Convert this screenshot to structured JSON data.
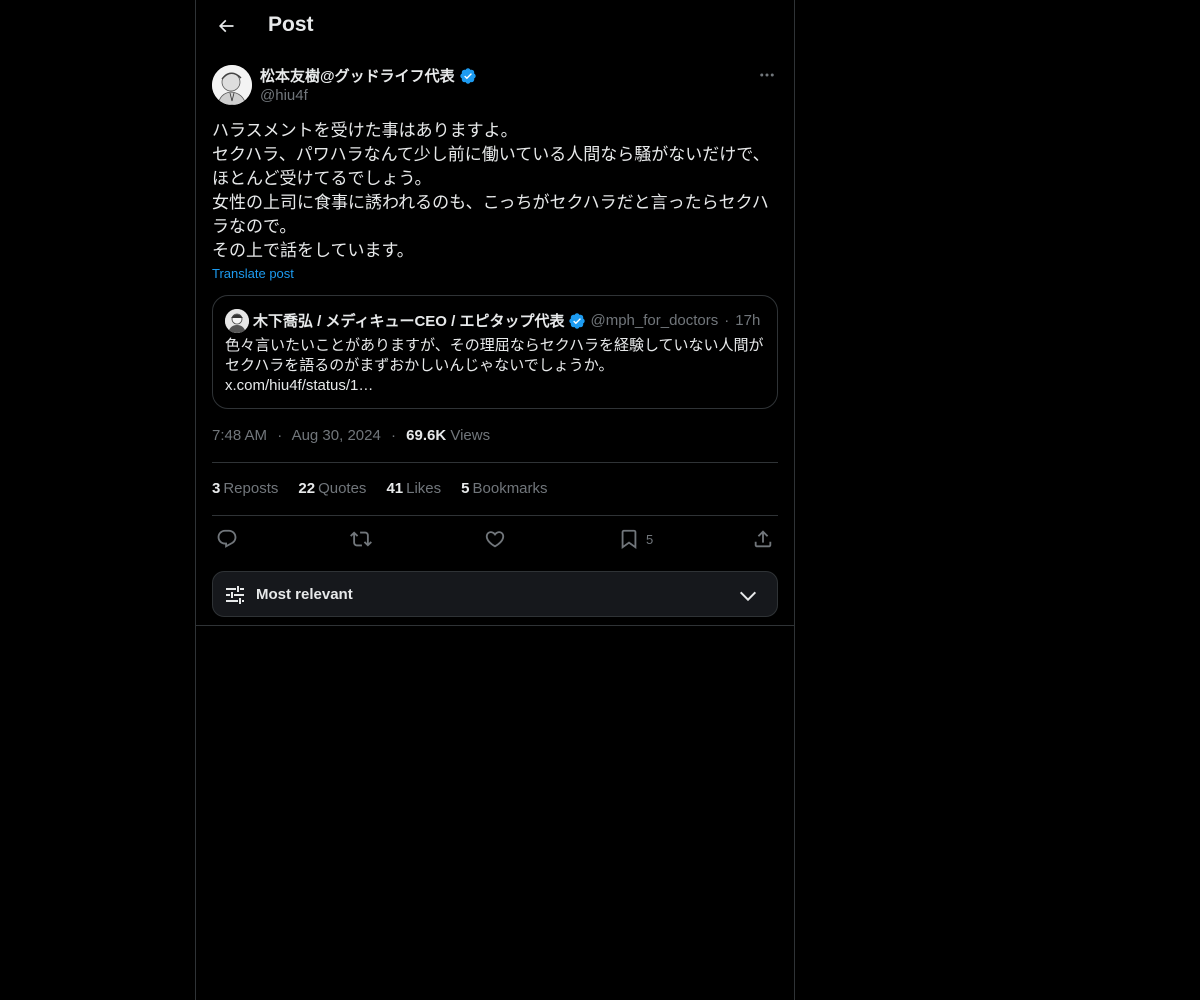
{
  "header": {
    "title": "Post"
  },
  "post": {
    "author_name": "松本友樹@グッドライフ代表",
    "author_handle": "@hiu4f",
    "body_lines": [
      "ハラスメントを受けた事はありますよ。",
      "セクハラ、パワハラなんて少し前に働いている人間なら騒がないだけで、",
      "ほとんど受けてるでしょう。",
      "女性の上司に食事に誘われるのも、こっちがセクハラだと言ったらセクハ",
      "ラなので。",
      "その上で話をしています。"
    ],
    "translate_label": "Translate post",
    "time": "7:48 AM",
    "date": "Aug 30, 2024",
    "views_count": "69.6K",
    "views_label": "Views"
  },
  "quote": {
    "author_name": "木下喬弘 / メディキューCEO / エピタップ代表",
    "author_handle": "@mph_for_doctors",
    "separator": "·",
    "time": "17h",
    "text_lines": [
      "色々言いたいことがありますが、その理屈ならセクハラを経験していない人間が",
      "セクハラを語るのがまずおかしいんじゃないでしょうか。",
      "x.com/hiu4f/status/1…"
    ]
  },
  "stats": [
    {
      "count": "3",
      "label": "Reposts"
    },
    {
      "count": "22",
      "label": "Quotes"
    },
    {
      "count": "41",
      "label": "Likes"
    },
    {
      "count": "5",
      "label": "Bookmarks"
    }
  ],
  "actions": {
    "reply_icon": "reply-icon",
    "repost_icon": "repost-icon",
    "like_icon": "heart-icon",
    "bookmark_icon": "bookmark-icon",
    "bookmark_count": "5",
    "share_icon": "share-icon"
  },
  "sort": {
    "label": "Most relevant"
  },
  "colors": {
    "background": "#000000",
    "text": "#e7e9ea",
    "secondary": "#71767b",
    "accent": "#1d9bf0",
    "border": "#2f3336"
  }
}
